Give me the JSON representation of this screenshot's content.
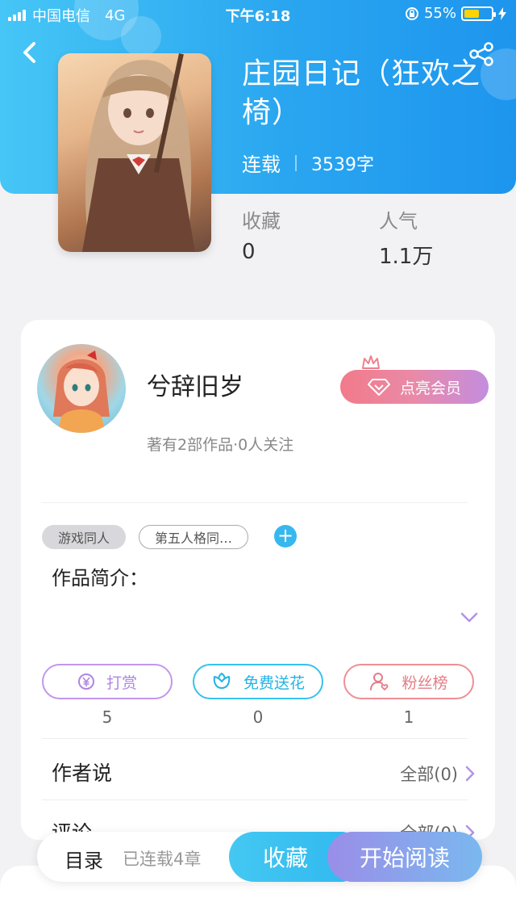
{
  "status_bar": {
    "carrier": "中国电信",
    "network": "4G",
    "time": "下午6:18",
    "battery": "55%",
    "battery_level": 0.55
  },
  "book": {
    "title": "庄园日记（狂欢之椅）",
    "status": "连载",
    "word_count": "3539字",
    "stats": [
      {
        "label": "收藏",
        "value": "0"
      },
      {
        "label": "人气",
        "value": "1.1万"
      }
    ]
  },
  "author": {
    "name": "兮辞旧岁",
    "info": "著有2部作品·0人关注",
    "vip_button": "点亮会员"
  },
  "tags": [
    "游戏同人",
    "第五人格同…"
  ],
  "intro_label": "作品简介：",
  "actions": [
    {
      "label": "打赏",
      "count": "5",
      "icon": "yen-coin-icon",
      "color": "#b085e3"
    },
    {
      "label": "免费送花",
      "count": "0",
      "icon": "flower-icon",
      "color": "#22b3e6"
    },
    {
      "label": "粉丝榜",
      "count": "1",
      "icon": "fan-user-icon",
      "color": "#e57c86"
    }
  ],
  "sections": [
    {
      "label": "作者说",
      "link": "全部(0)"
    },
    {
      "label": "评论",
      "link": "全部(0)"
    }
  ],
  "bottom_bar": {
    "toc": "目录",
    "chapters": "已连载4章",
    "favorite": "收藏",
    "read": "开始阅读"
  }
}
